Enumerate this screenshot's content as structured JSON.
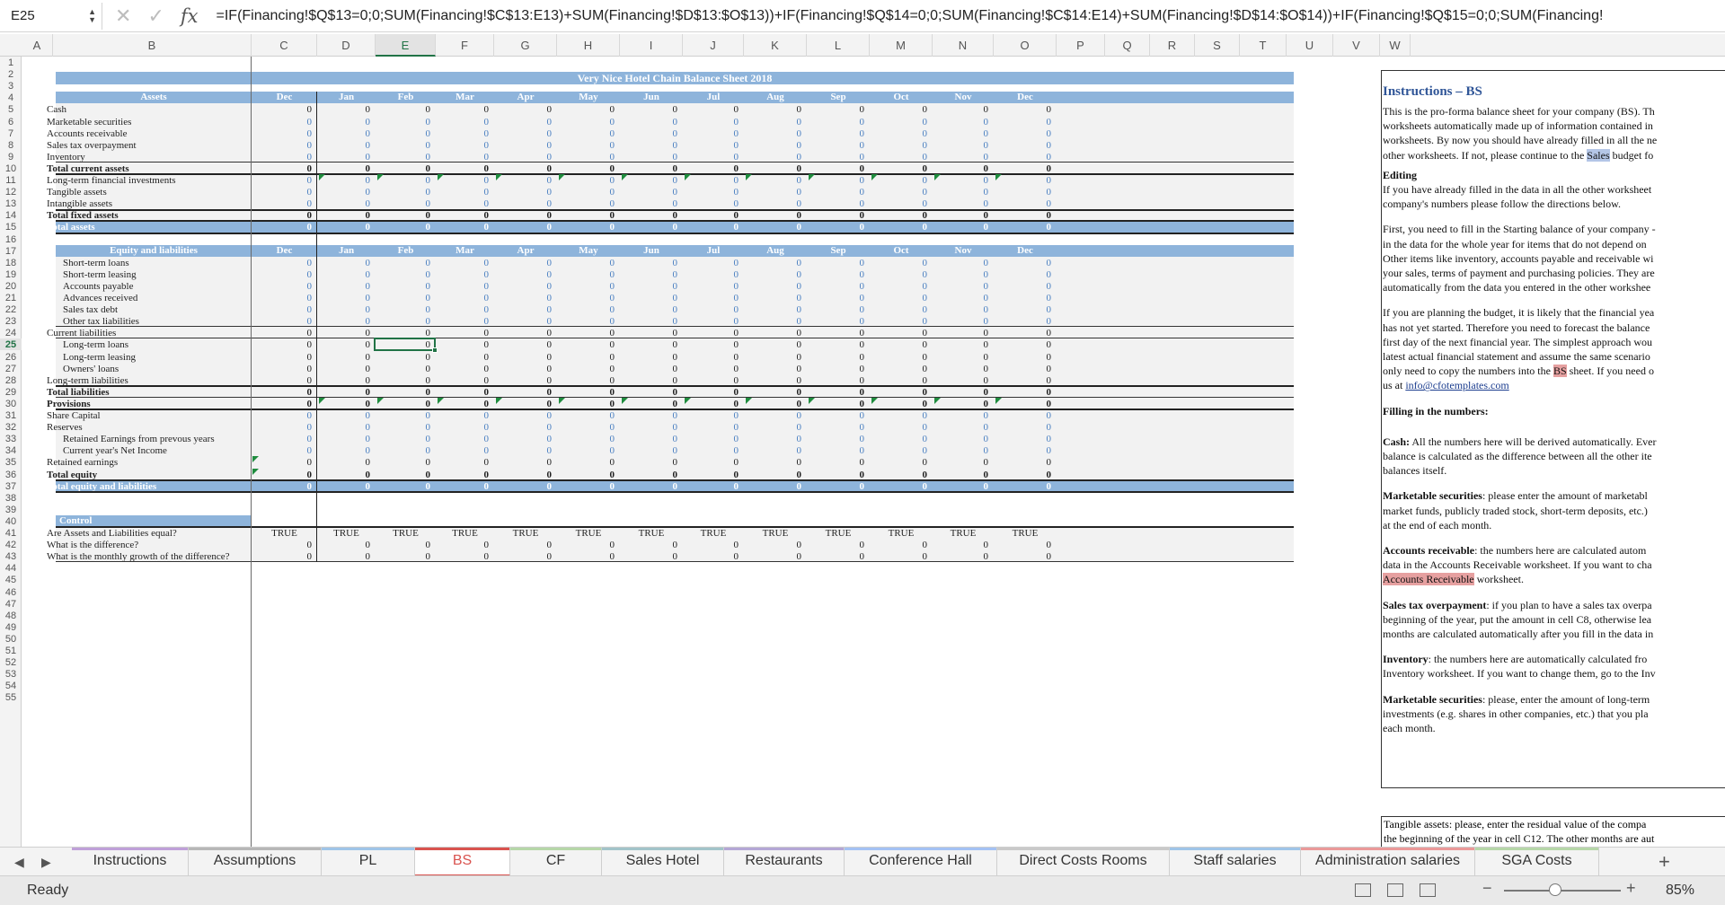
{
  "formula_bar": {
    "cell_ref": "E25",
    "formula": "=IF(Financing!$Q$13=0;0;SUM(Financing!$C$13:E13)+SUM(Financing!$D$13:$O$13))+IF(Financing!$Q$14=0;0;SUM(Financing!$C$14:E14)+SUM(Financing!$D$14:$O$14))+IF(Financing!$Q$15=0;0;SUM(Financing!"
  },
  "columns": [
    "A",
    "B",
    "C",
    "D",
    "E",
    "F",
    "G",
    "H",
    "I",
    "J",
    "K",
    "L",
    "M",
    "N",
    "O",
    "P",
    "Q",
    "R",
    "S",
    "T",
    "U",
    "V",
    "W"
  ],
  "rows": [
    "1",
    "2",
    "3",
    "4",
    "5",
    "6",
    "7",
    "8",
    "9",
    "10",
    "11",
    "12",
    "13",
    "14",
    "15",
    "16",
    "17",
    "18",
    "19",
    "20",
    "21",
    "22",
    "23",
    "24",
    "25",
    "26",
    "27",
    "28",
    "29",
    "30",
    "31",
    "32",
    "33",
    "34",
    "35",
    "36",
    "37",
    "38",
    "39",
    "40",
    "41",
    "42",
    "43",
    "44",
    "45",
    "46",
    "47",
    "48",
    "49",
    "50",
    "51",
    "52",
    "53",
    "54",
    "55"
  ],
  "sheet": {
    "title": "Very Nice Hotel Chain Balance Sheet 2018",
    "months": [
      "Dec",
      "Jan",
      "Feb",
      "Mar",
      "Apr",
      "May",
      "Jun",
      "Jul",
      "Aug",
      "Sep",
      "Oct",
      "Nov",
      "Dec"
    ],
    "assets_header": "Assets",
    "assets": [
      {
        "label": "Cash",
        "style": "normal"
      },
      {
        "label": "Marketable securities",
        "style": "blue"
      },
      {
        "label": "Accounts receivable",
        "style": "blue"
      },
      {
        "label": "Sales tax overpayment",
        "style": "blue"
      },
      {
        "label": "Inventory",
        "style": "blue"
      },
      {
        "label": "Total current assets",
        "style": "bold"
      },
      {
        "label": "Long-term financial investments",
        "style": "blue"
      },
      {
        "label": "Tangible assets",
        "style": "blue"
      },
      {
        "label": "Intangible assets",
        "style": "blue"
      },
      {
        "label": "Total fixed assets",
        "style": "bold"
      },
      {
        "label": "Total assets",
        "style": "total"
      }
    ],
    "liab_header": "Equity and liabilities",
    "liabilities": [
      {
        "label": "Short-term loans",
        "indent": true
      },
      {
        "label": "Short-term leasing",
        "indent": true
      },
      {
        "label": "Accounts payable",
        "indent": true
      },
      {
        "label": "Advances received",
        "indent": true
      },
      {
        "label": "Sales tax debt",
        "indent": true
      },
      {
        "label": "Other tax liabilities",
        "indent": true
      },
      {
        "label": "Current liabilities",
        "indent": false
      },
      {
        "label": "Long-term loans",
        "indent": true
      },
      {
        "label": "Long-term leasing",
        "indent": true
      },
      {
        "label": "Owners' loans",
        "indent": true
      },
      {
        "label": "Long-term liabilities",
        "indent": false
      },
      {
        "label": "Total liabilities",
        "indent": false,
        "bold": true
      },
      {
        "label": "Provisions",
        "indent": false,
        "bold": true
      },
      {
        "label": "Share Capital",
        "indent": false
      },
      {
        "label": "Reserves",
        "indent": false
      },
      {
        "label": "Retained Earnings from prevous years",
        "indent": true
      },
      {
        "label": "Current year's Net Income",
        "indent": true
      },
      {
        "label": "Retained earnings",
        "indent": false
      },
      {
        "label": "Total equity",
        "indent": false,
        "bold": true
      },
      {
        "label": "Total equity and liabilities",
        "indent": false,
        "total": true
      }
    ],
    "control_header": "Control",
    "control": [
      {
        "label": "Are Assets and Liabilities equal?",
        "value": "TRUE"
      },
      {
        "label": "What is the difference?",
        "value": "0"
      },
      {
        "label": "What is the monthly growth of the difference?",
        "value": "0"
      }
    ],
    "zero": "0"
  },
  "instructions": {
    "title": "Instructions – BS",
    "p1": [
      "This is the pro-forma balance sheet for your company (BS). Th",
      "worksheets automatically made up of information contained in",
      "worksheets. By now you should have already filled in all the ne"
    ],
    "p1_last_a": "other worksheets. If not, please continue to the ",
    "p1_last_hl": "Sales",
    "p1_last_b": " budget fo",
    "editing_h": "Editing",
    "p2": [
      "If you have already filled in the data in all the other worksheet",
      "company's numbers please follow the directions below."
    ],
    "p3": [
      "First, you need to fill in the Starting balance of your company -",
      "in the data for the whole year for items that do not depend on",
      "Other items like inventory, accounts payable and receivable wi",
      "your sales, terms of payment and purchasing policies. They are",
      "automatically from the data you entered in the other workshee"
    ],
    "p4": [
      "If you are planning the budget, it is likely that the financial yea",
      "has not yet started. Therefore you need to forecast the balance",
      "first day of the next financial year. The simplest approach wou",
      "latest actual financial statement and assume the same scenario"
    ],
    "p4_line5_a": "only need to copy the numbers into the ",
    "p4_line5_hl": "BS",
    "p4_line5_b": " sheet. If you need o",
    "p4_line6_a": "us at ",
    "p4_link": "info@cfotemplates.com",
    "filling_h": "Filling in the numbers:",
    "cash_h": "Cash:",
    "cash": [
      " All the numbers here will be derived automatically. Ever",
      "balance is calculated as the difference between all the other ite",
      "balances itself."
    ],
    "ms_h": "Marketable securities",
    "ms": [
      ": please enter the amount of marketabl",
      "market funds, publicly traded stock, short-term deposits, etc.)",
      "at the end of each month."
    ],
    "ar_h": "Accounts receivable",
    "ar": [
      ": the numbers here are calculated autom",
      "data in the Accounts Receivable worksheet. If you want to cha"
    ],
    "ar_hl": "Accounts Receivable",
    "ar_tail": " worksheet.",
    "st_h": "Sales tax overpayment",
    "st": [
      ": if you plan to have a sales tax overpa",
      "beginning of the year, put the amount in cell C8, otherwise lea",
      "months are calculated automatically after you fill in the data in"
    ],
    "inv_h": "Inventory",
    "inv": [
      ": the numbers here are automatically calculated fro",
      "Inventory worksheet. If you want to change them, go to the Inv"
    ],
    "ms2_h": "Marketable securities",
    "ms2": [
      ": please, enter the amount of long-term",
      "investments (e.g. shares in other companies, etc.) that you pla",
      "each month."
    ],
    "ta_h": "Tangible assets",
    "ta": [
      ": please, enter the residual value of the compa",
      "the beginning of the year in cell C12. The other months are aut"
    ]
  },
  "tabs": [
    "Instructions",
    "Assumptions",
    "PL",
    "BS",
    "CF",
    "Sales Hotel",
    "Restaurants",
    "Conference Hall",
    "Direct Costs Rooms",
    "Staff salaries",
    "Administration salaries",
    "SGA Costs"
  ],
  "active_tab": "BS",
  "status": {
    "ready": "Ready",
    "zoom": "85%"
  },
  "colors": {
    "accent": "#217346",
    "header_bar": "#8eb4db",
    "active_tab": "#d9534f"
  }
}
